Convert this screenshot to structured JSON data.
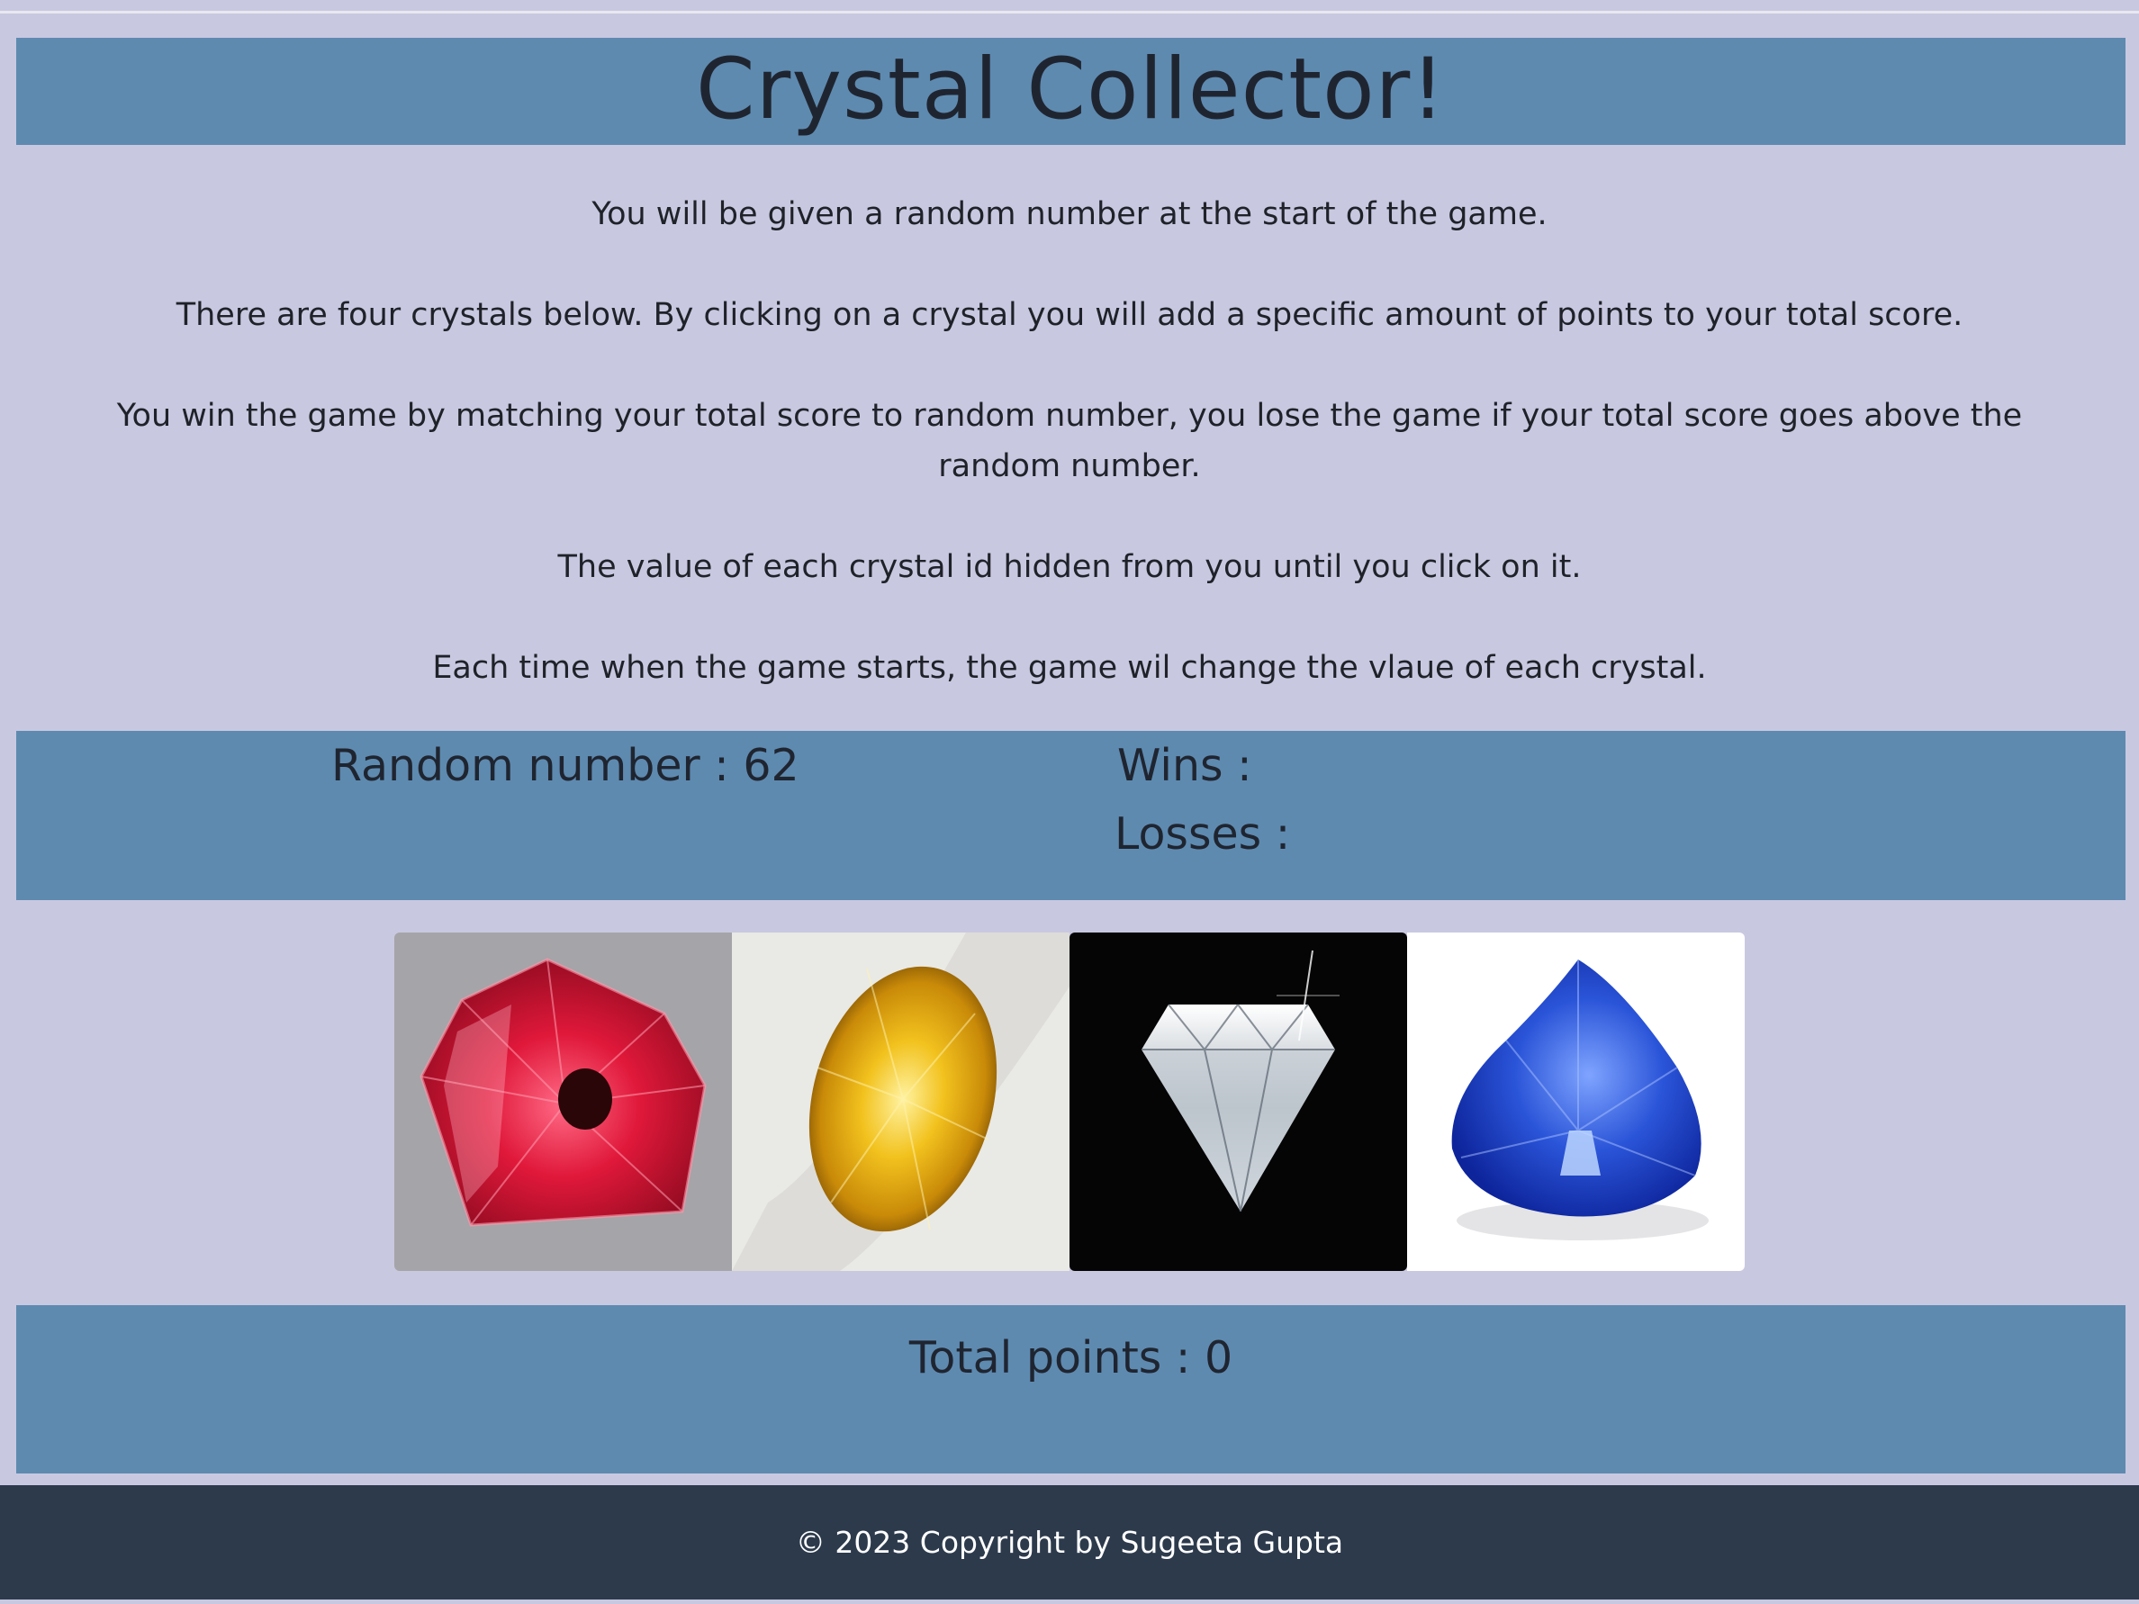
{
  "header": {
    "title": "Crystal Collector!"
  },
  "rules": [
    "You will be given a random number at the start of the game.",
    "There are four crystals below. By clicking on a crystal you will add a specific amount of points to your total score.",
    "You win the game by matching your total score to random number, you lose the game if your total score goes above the random number.",
    "The value of each crystal id hidden from you until you click on it.",
    "Each time when the game starts, the game wil change the vlaue of each crystal."
  ],
  "stats": {
    "random_label": "Random number : 62",
    "wins_label": "Wins :",
    "losses_label": "Losses :"
  },
  "crystals": [
    {
      "name": "red-crystal",
      "color": "#d81f3c"
    },
    {
      "name": "yellow-crystal",
      "color": "#e8b11a"
    },
    {
      "name": "diamond-crystal",
      "color": "#e6eef4"
    },
    {
      "name": "blue-crystal",
      "color": "#2446c9"
    }
  ],
  "total": {
    "label": "Total points : 0"
  },
  "footer": {
    "text": "© 2023 Copyright by Sugeeta Gupta"
  },
  "colors": {
    "background": "#c9c8e1",
    "band": "#5e8ab0",
    "footer": "#2c3a4c"
  }
}
